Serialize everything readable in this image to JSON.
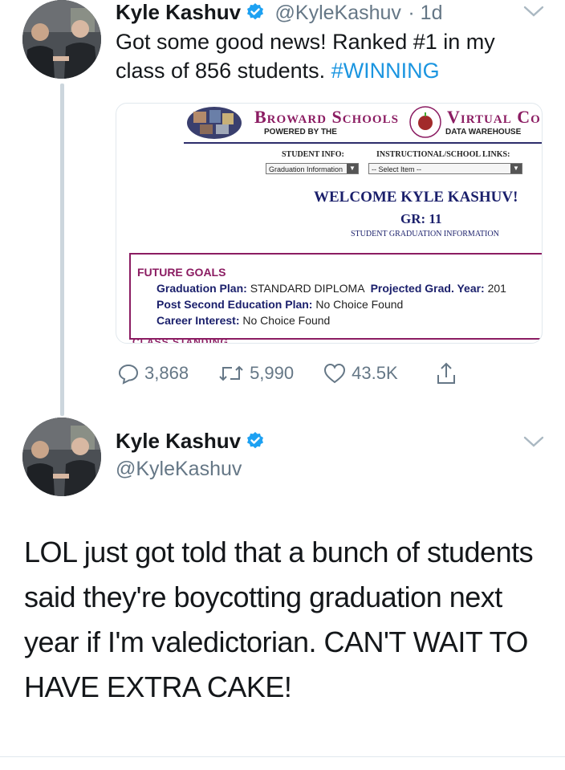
{
  "tweet1": {
    "name": "Kyle Kashuv",
    "handle": "@KyleKashuv",
    "time": "· 1d",
    "text": "Got some good news! Ranked #1 in my class of 856 students.",
    "hashtag": "#WINNING",
    "card": {
      "logo_left": "Broward Schools",
      "logo_right": "Virtual Co",
      "powered_by": "POWERED BY THE",
      "data_warehouse": "DATA WAREHOUSE",
      "student_info_label": "STUDENT INFO:",
      "links_label": "INSTRUCTIONAL/SCHOOL LINKS:",
      "student_info_select": "Graduation Information",
      "links_select": "-- Select Item --",
      "welcome": "WELCOME KYLE KASHUV!",
      "grade": "GR: 11",
      "subheading": "STUDENT GRADUATION INFORMATION",
      "future_goals": "FUTURE GOALS",
      "grad_plan_label": "Graduation Plan:",
      "grad_plan_value": "STANDARD DIPLOMA",
      "projected_label": "Projected Grad. Year:",
      "projected_value": "201",
      "post_second_label": "Post Second Education Plan:",
      "post_second_value": "No Choice Found",
      "career_label": "Career Interest:",
      "career_value": "No Choice Found",
      "class_standing": "CLASS STANDING"
    },
    "actions": {
      "replies": "3,868",
      "retweets": "5,990",
      "likes": "43.5K"
    }
  },
  "tweet2": {
    "name": "Kyle Kashuv",
    "handle": "@KyleKashuv",
    "text": "LOL just got told that a bunch of students said they're boycotting graduation next year if I'm valedictorian. CAN'T WAIT TO HAVE EXTRA CAKE!"
  },
  "colors": {
    "link": "#1b95e0",
    "verified": "#1da1f2",
    "muted": "#657786"
  }
}
